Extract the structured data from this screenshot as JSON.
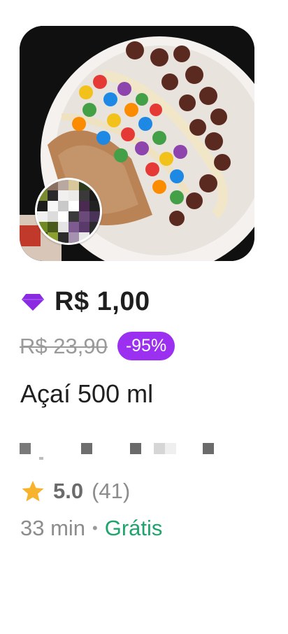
{
  "product": {
    "image_icon": "acai-bowl-photo",
    "price": "R$ 1,00",
    "old_price": "R$ 23,90",
    "discount": "-95%",
    "name": "Açaí 500 ml"
  },
  "store": {
    "avatar_icon": "store-logo-avatar",
    "name_obscured": true
  },
  "rating": {
    "value": "5.0",
    "count": "(41)"
  },
  "delivery": {
    "time": "33 min",
    "separator": "•",
    "fee": "Grátis"
  },
  "colors": {
    "club_purple": "#8a2be2",
    "discount_bg": "#9b30f0",
    "star": "#f7b32b",
    "free_green": "#1ea56b"
  }
}
